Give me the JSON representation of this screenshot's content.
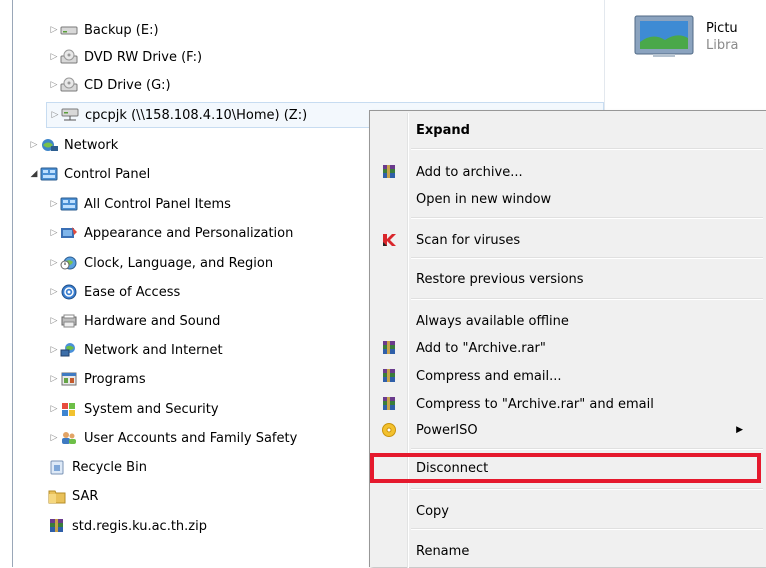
{
  "nav_tree": [
    {
      "label": "Backup (E:)",
      "icon": "drive-icon",
      "arrow": "collapsed"
    },
    {
      "label": "DVD RW Drive (F:)",
      "icon": "dvd-drive-icon",
      "arrow": "collapsed"
    },
    {
      "label": "CD Drive (G:)",
      "icon": "cd-drive-icon",
      "arrow": "collapsed"
    },
    {
      "label": "cpcpjk (\\\\158.108.4.10\\Home) (Z:)",
      "icon": "network-drive-icon",
      "arrow": "collapsed",
      "selected": true
    },
    {
      "label": "Network",
      "icon": "network-icon",
      "arrow": "collapsed"
    },
    {
      "label": "Control Panel",
      "icon": "control-panel-icon",
      "arrow": "expanded"
    },
    {
      "label": "All Control Panel Items",
      "icon": "control-panel-icon",
      "arrow": "collapsed"
    },
    {
      "label": "Appearance and Personalization",
      "icon": "appearance-icon",
      "arrow": "collapsed"
    },
    {
      "label": "Clock, Language, and Region",
      "icon": "clock-globe-icon",
      "arrow": "collapsed"
    },
    {
      "label": "Ease of Access",
      "icon": "ease-of-access-icon",
      "arrow": "collapsed"
    },
    {
      "label": "Hardware and Sound",
      "icon": "hardware-icon",
      "arrow": "collapsed"
    },
    {
      "label": "Network and Internet",
      "icon": "network-internet-icon",
      "arrow": "collapsed"
    },
    {
      "label": "Programs",
      "icon": "programs-icon",
      "arrow": "collapsed"
    },
    {
      "label": "System and Security",
      "icon": "system-security-icon",
      "arrow": "collapsed"
    },
    {
      "label": "User Accounts and Family Safety",
      "icon": "user-accounts-icon",
      "arrow": "collapsed"
    },
    {
      "label": "Recycle Bin",
      "icon": "recycle-bin-icon",
      "arrow": "none"
    },
    {
      "label": "SAR",
      "icon": "folder-icon",
      "arrow": "none"
    },
    {
      "label": "std.regis.ku.ac.th.zip",
      "icon": "winrar-archive-icon",
      "arrow": "none"
    }
  ],
  "right_pane": {
    "item_title": "Pictu",
    "item_subtitle": "Libra",
    "icon": "pictures-library-icon"
  },
  "context_menu": {
    "items": [
      {
        "label": "Expand",
        "bold": true,
        "icon": ""
      },
      {
        "label": "Add to archive...",
        "icon": "winrar-icon"
      },
      {
        "label": "Open in new window",
        "icon": ""
      },
      {
        "label": "Scan for viruses",
        "icon": "kaspersky-icon"
      },
      {
        "label": "Restore previous versions",
        "icon": ""
      },
      {
        "label": "Always available offline",
        "icon": ""
      },
      {
        "label": "Add to \"Archive.rar\"",
        "icon": "winrar-icon"
      },
      {
        "label": "Compress and email...",
        "icon": "winrar-icon"
      },
      {
        "label": "Compress to \"Archive.rar\" and email",
        "icon": "winrar-icon"
      },
      {
        "label": "PowerISO",
        "icon": "poweriso-icon",
        "submenu": true
      },
      {
        "label": "Disconnect",
        "icon": "",
        "highlighted": true
      },
      {
        "label": "Copy",
        "icon": ""
      },
      {
        "label": "Rename",
        "icon": ""
      }
    ],
    "highlight_color": "#e5192d"
  },
  "colors": {
    "selection_bg": "#f3f8fd",
    "selection_border": "#c7dcf1",
    "menu_bg": "#f0f0f0"
  }
}
